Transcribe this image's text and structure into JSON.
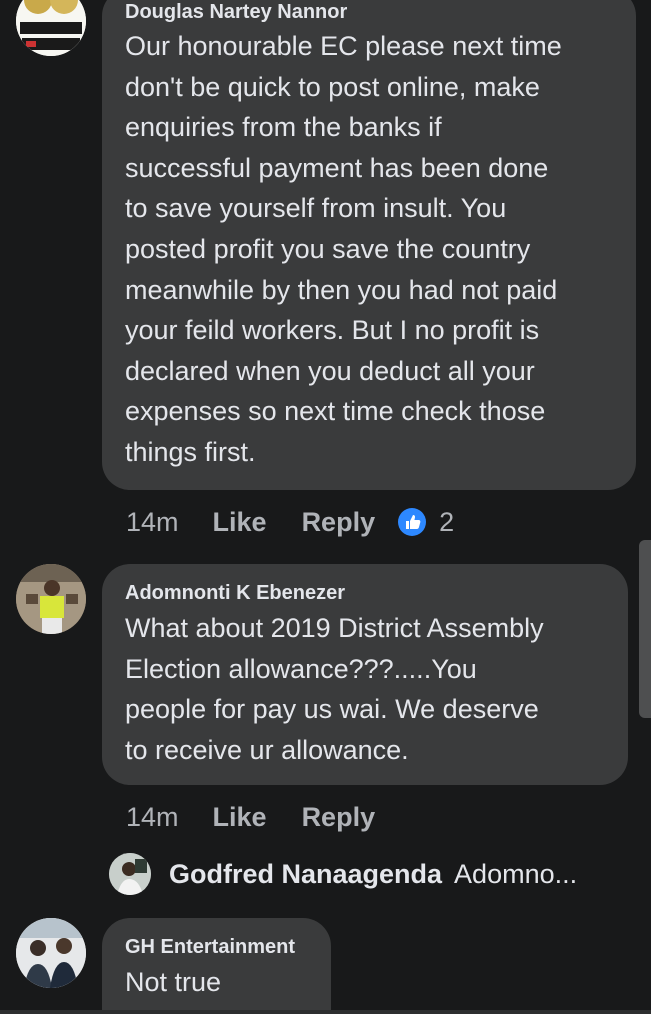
{
  "comments": [
    {
      "author": "Douglas Nartey Nannor",
      "avatar_label": "OLD 500 COIN",
      "lines": [
        "Our honourable EC please next time",
        "don't be quick to post online, make",
        "enquiries from the banks if",
        "successful payment has been done",
        "to save yourself from insult. You",
        "posted profit you save the country",
        "meanwhile by then you had not paid",
        "your feild workers. But I no profit is",
        "declared when you deduct all your",
        "expenses so next time check those",
        "things first."
      ],
      "time": "14m",
      "like_label": "Like",
      "reply_label": "Reply",
      "reaction_count": "2"
    },
    {
      "author": "Adomnonti K Ebenezer",
      "lines": [
        "What about 2019 District Assembly",
        "Election allowance???.....You",
        "people for pay us wai. We deserve",
        "to receive ur allowance."
      ],
      "time": "14m",
      "like_label": "Like",
      "reply_label": "Reply",
      "reply_preview": {
        "name": "Godfred Nanaagenda",
        "text": "Adomno..."
      }
    },
    {
      "author": "GH Entertainment",
      "lines": [
        "Not true"
      ]
    }
  ],
  "colors": {
    "background": "#18191a",
    "bubble": "#3a3b3c",
    "text": "#e4e6eb",
    "muted": "#b0b3b8",
    "like_blue": "#2d88ff"
  },
  "icons": {
    "reaction": "thumbs-up-icon"
  }
}
